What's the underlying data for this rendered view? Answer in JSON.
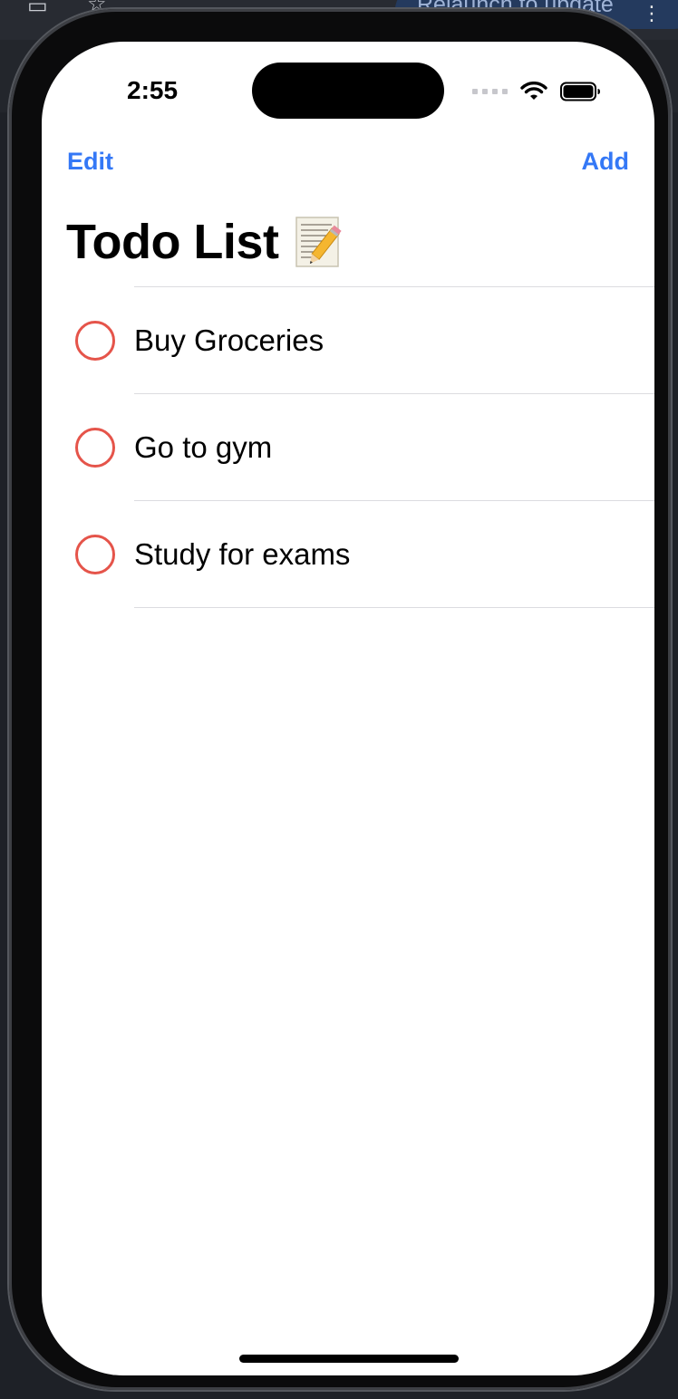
{
  "desktop": {
    "relaunch_label": "Relaunch to update"
  },
  "status_bar": {
    "time": "2:55"
  },
  "nav": {
    "edit_label": "Edit",
    "add_label": "Add"
  },
  "page": {
    "title": "Todo List"
  },
  "todos": [
    {
      "label": "Buy Groceries"
    },
    {
      "label": "Go to gym"
    },
    {
      "label": "Study for exams"
    }
  ],
  "colors": {
    "accent": "#3478f6",
    "todo_circle": "#e5544a"
  }
}
